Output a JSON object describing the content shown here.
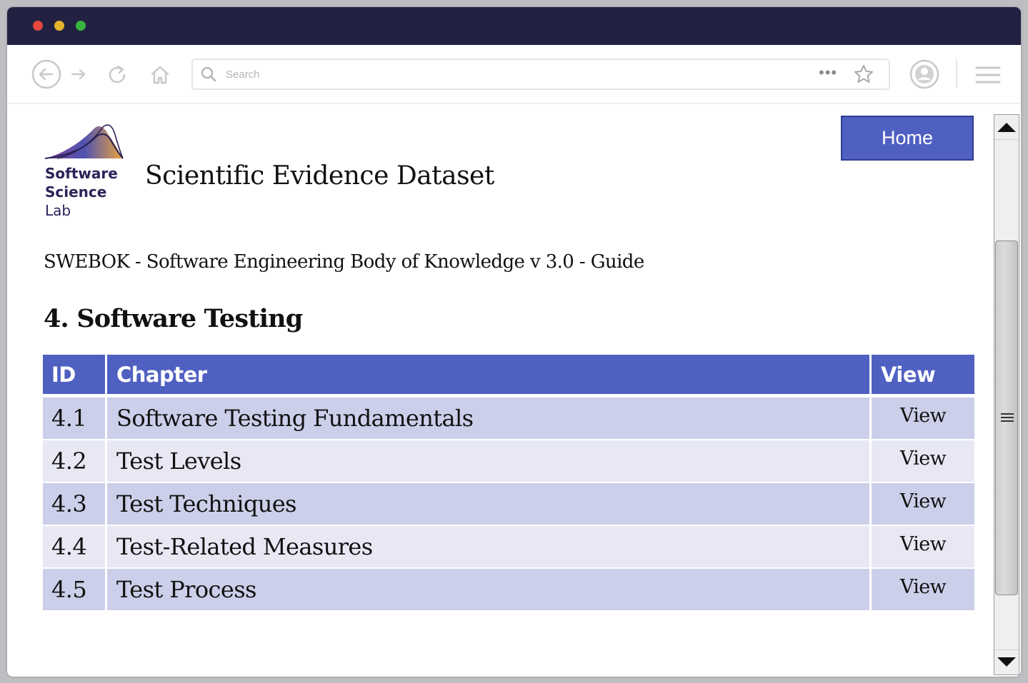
{
  "browser": {
    "search_placeholder": "Search",
    "more_label": "•••"
  },
  "site": {
    "logo_lines": [
      "Software",
      "Science",
      "Lab"
    ],
    "title": "Scientific Evidence Dataset",
    "home_button": "Home"
  },
  "page": {
    "subtitle": "SWEBOK - Software Engineering Body of Knowledge v 3.0 - Guide",
    "section_heading": "4. Software Testing"
  },
  "table": {
    "headers": {
      "id": "ID",
      "chapter": "Chapter",
      "view": "View"
    },
    "rows": [
      {
        "id": "4.1",
        "chapter": "Software Testing Fundamentals",
        "view": "View"
      },
      {
        "id": "4.2",
        "chapter": "Test Levels",
        "view": "View"
      },
      {
        "id": "4.3",
        "chapter": "Test Techniques",
        "view": "View"
      },
      {
        "id": "4.4",
        "chapter": "Test-Related Measures",
        "view": "View"
      },
      {
        "id": "4.5",
        "chapter": "Test Process",
        "view": "View"
      }
    ]
  },
  "colors": {
    "titlebar": "#232142",
    "accent": "#4f60c1",
    "row_odd": "#cbcfe9",
    "row_even": "#e7e8f4"
  }
}
